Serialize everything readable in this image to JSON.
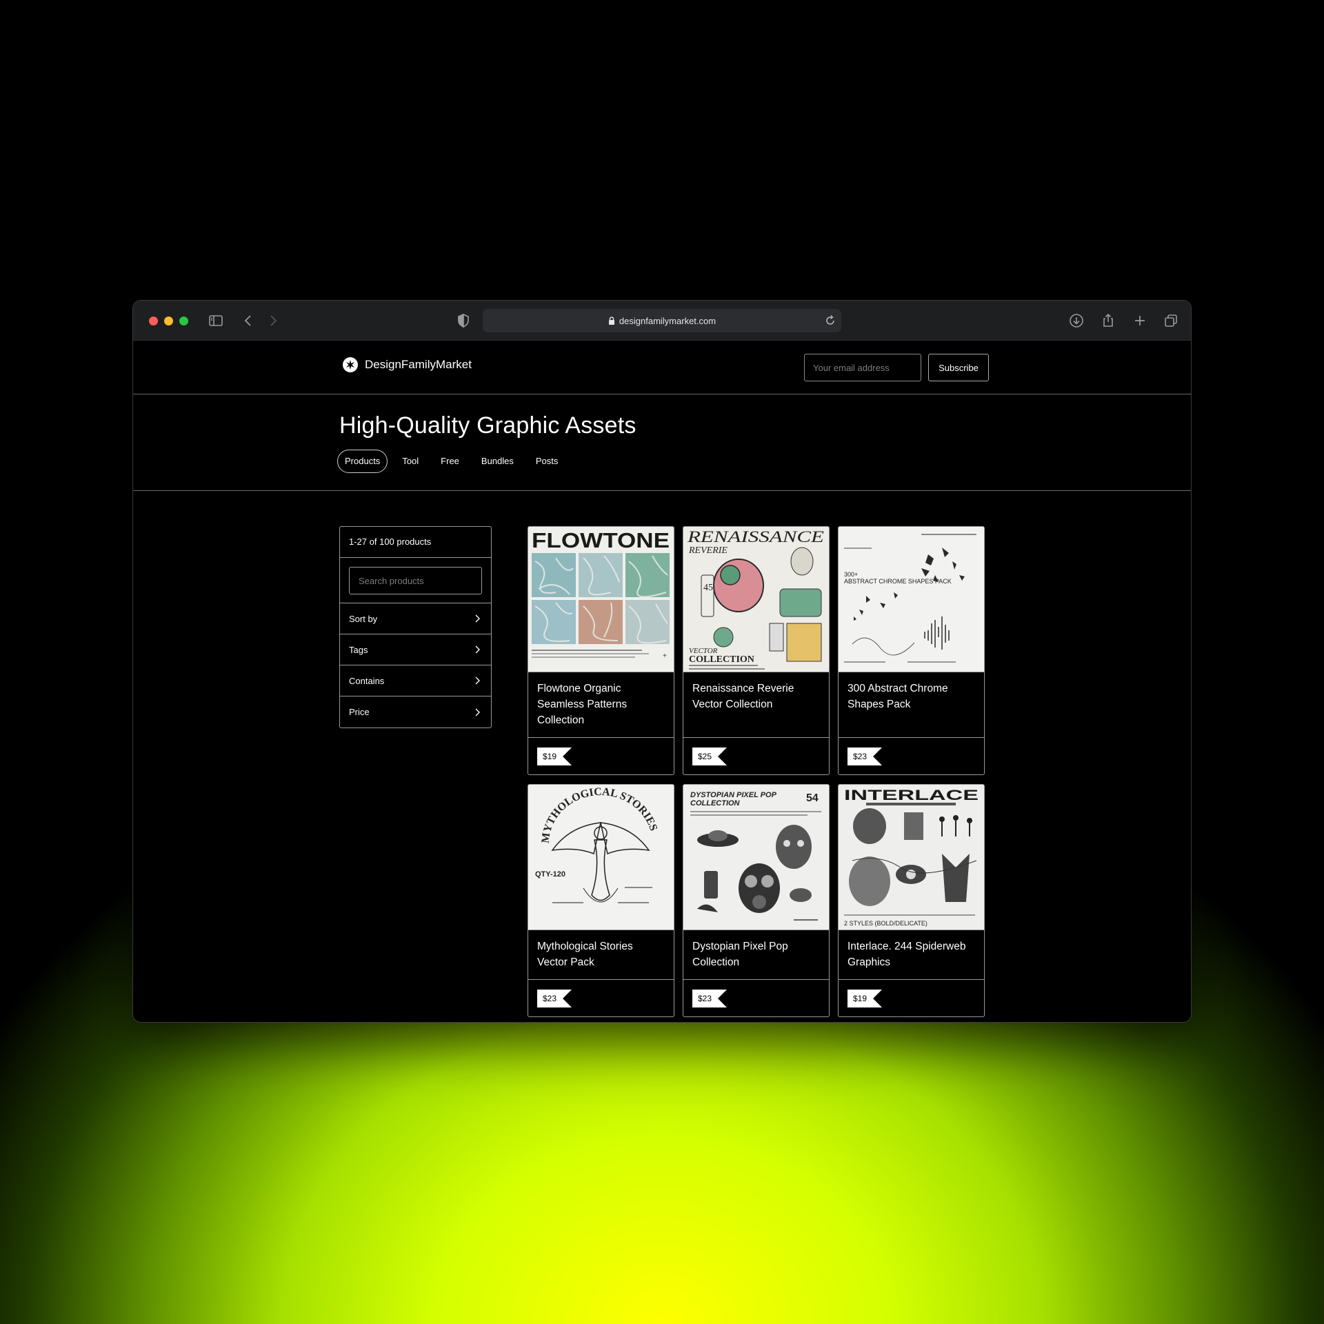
{
  "browser": {
    "url": "designfamilymarket.com"
  },
  "site": {
    "brand": "DesignFamilyMarket",
    "email_placeholder": "Your email address",
    "subscribe_label": "Subscribe"
  },
  "hero": {
    "title": "High-Quality Graphic Assets",
    "tabs": [
      {
        "label": "Products",
        "active": true
      },
      {
        "label": "Tool",
        "active": false
      },
      {
        "label": "Free",
        "active": false
      },
      {
        "label": "Bundles",
        "active": false
      },
      {
        "label": "Posts",
        "active": false
      }
    ]
  },
  "sidebar": {
    "count": "1-27 of 100 products",
    "search_placeholder": "Search products",
    "filters": [
      "Sort by",
      "Tags",
      "Contains",
      "Price"
    ]
  },
  "products": [
    {
      "title": "Flowtone Organic Seamless Patterns Collection",
      "price": "$19",
      "image_text": "FLOWTONE"
    },
    {
      "title": "Renaissance Reverie Vector Collection",
      "price": "$25",
      "image_text": "RENAISSANCE"
    },
    {
      "title": "300 Abstract Chrome Shapes Pack",
      "price": "$23",
      "image_text": "300+"
    },
    {
      "title": "Mythological Stories Vector Pack",
      "price": "$23",
      "image_text": "MYTHOLOGICAL STORIES"
    },
    {
      "title": "Dystopian Pixel Pop Collection",
      "price": "$23",
      "image_text": "DYSTOPIAN PIXEL POP"
    },
    {
      "title": "Interlace. 244 Spiderweb Graphics",
      "price": "$19",
      "image_text": "INTERLACE"
    }
  ]
}
